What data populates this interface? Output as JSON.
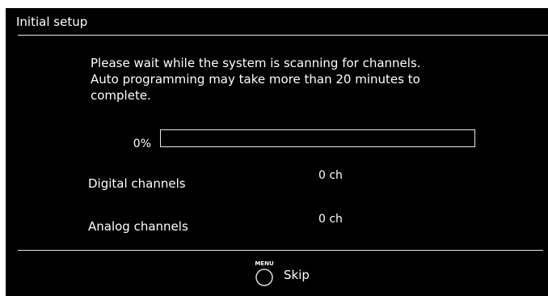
{
  "dialog": {
    "title": "Initial setup",
    "message_lines": [
      "Please wait while the system is scanning for channels.",
      "Auto programming may take more than 20 minutes to",
      "complete."
    ]
  },
  "progress": {
    "label": "0%",
    "fraction": 0
  },
  "channels": {
    "digital": {
      "label": "Digital channels",
      "value": "0 ch"
    },
    "analog": {
      "label": "Analog channels",
      "value": "0 ch"
    }
  },
  "footer": {
    "button_icon": "menu-button-icon",
    "button_caption": "MENU",
    "action_label": "Skip"
  },
  "colors": {
    "background": "#000000",
    "text": "#ffffff",
    "divider": "#e6e6e6"
  }
}
